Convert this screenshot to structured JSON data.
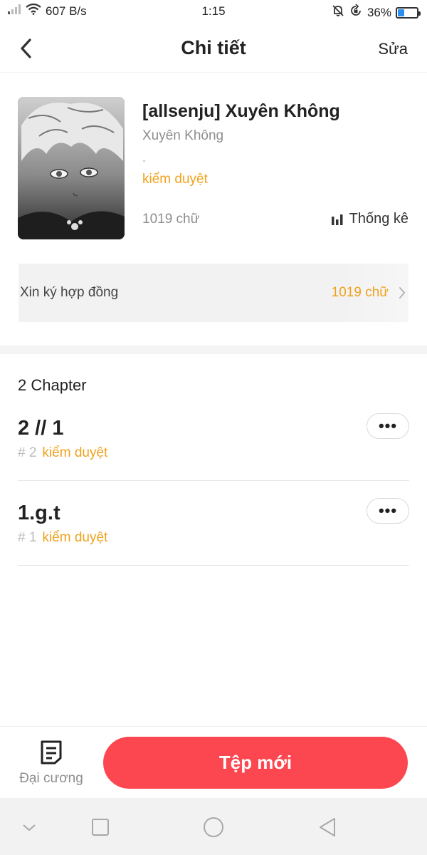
{
  "status_bar": {
    "network_speed": "607 B/s",
    "time": "1:15",
    "battery_percent": "36%",
    "battery_level": 0.36,
    "icons": [
      "signal-icon",
      "wifi-icon",
      "mute-icon",
      "rotation-lock-icon",
      "battery-icon"
    ]
  },
  "header": {
    "title": "Chi tiết",
    "edit_label": "Sửa",
    "back_icon": "back-arrow-icon"
  },
  "book": {
    "title": "[allsenju] Xuyên Không",
    "genre": "Xuyên Không",
    "description": ".",
    "status": "kiểm duyệt",
    "word_count": "1019 chữ",
    "stats_label": "Thống kê"
  },
  "contract": {
    "label": "Xin ký hợp đồng",
    "value": "1019 chữ"
  },
  "chapters": {
    "count_label": "2 Chapter",
    "items": [
      {
        "title": "2 // 1",
        "number": "# 2",
        "status": "kiểm duyệt",
        "more": "•••"
      },
      {
        "title": "1.g.t",
        "number": "# 1",
        "status": "kiểm duyệt",
        "more": "•••"
      }
    ]
  },
  "bottom_bar": {
    "outline_label": "Đại cương",
    "new_file_label": "Tệp mới"
  },
  "colors": {
    "accent_orange": "#f0a21d",
    "primary_red": "#fd4750",
    "battery_blue": "#2b8ef0"
  }
}
